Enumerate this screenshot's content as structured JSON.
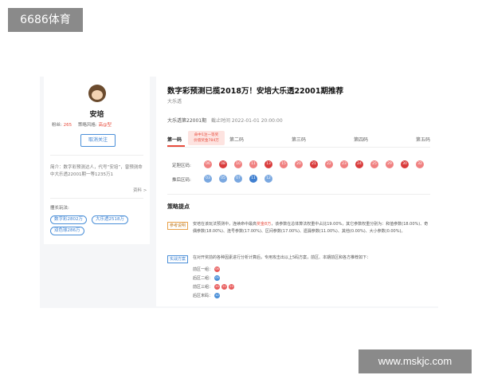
{
  "watermark_top": "6686体育",
  "watermark_bottom": "www.mskjc.com",
  "author": {
    "name": "安培",
    "stats": [
      {
        "label": "粉丝:",
        "value": "265"
      },
      {
        "label": "策略风格:",
        "value": "高@型"
      }
    ],
    "follow_label": "取消关注",
    "intro": "简介：数字彩预测达人，代号“安培”，曾预测命中大乐透22001期一等1235万1",
    "more_label": "资料 >",
    "record_label": "擅长玩法:",
    "chips": [
      "数字彩2802万",
      "大乐透2518万",
      "双色球286万"
    ]
  },
  "article": {
    "title": "数字彩预测已揽2018万！安培大乐透22001期推荐",
    "category": "大乐透",
    "period": "大乐透第22001期",
    "time": "截止时间 2022-01-01 20:00:00",
    "tabs": [
      "第一码",
      "第二码",
      "第三码",
      "第四码",
      "第五码"
    ],
    "promo_lines": [
      "命中1注一等奖",
      "价值奖金784万"
    ],
    "front_label": "定胆区码:",
    "back_label": "推后区码:",
    "front_balls": [
      "06",
      "08",
      "10",
      "11",
      "13",
      "15",
      "20",
      "21",
      "22",
      "23",
      "24",
      "25",
      "29",
      "30",
      "32"
    ],
    "back_balls": [
      "03",
      "05",
      "07",
      "11",
      "12"
    ],
    "section_title": "策略提点",
    "tag1": "参考说明",
    "para1_a": "安培在该玩法预测中，连续命中最高",
    "para1_hl": "奖金8万",
    "para1_b": "，该参数在总体算法权重中占比19.00%，其它参数权重分别为：和值参数(18.00%)、奇偶参数(18.00%)、连号参数(17.00%)、区间参数(17.00%)、遗漏参数(11.00%)、其他(0.00%)、大小参数(0.00%)。",
    "tag2": "实战方案",
    "para2": "在对开奖前的各种因素进行分析计算后，专用攻击出以上5码方案，前区、本期前区和各方推荐如下：",
    "zones": [
      {
        "label": "前区一组：",
        "balls": [
          "08"
        ],
        "color": "red"
      },
      {
        "label": "后区二组：",
        "balls": [
          "05"
        ],
        "color": "blue"
      },
      {
        "label": "前区三组：",
        "balls": [
          "20",
          "22",
          "23"
        ],
        "color": "red"
      },
      {
        "label": "后区末码：",
        "balls": [
          "12"
        ],
        "color": "blue"
      }
    ]
  }
}
